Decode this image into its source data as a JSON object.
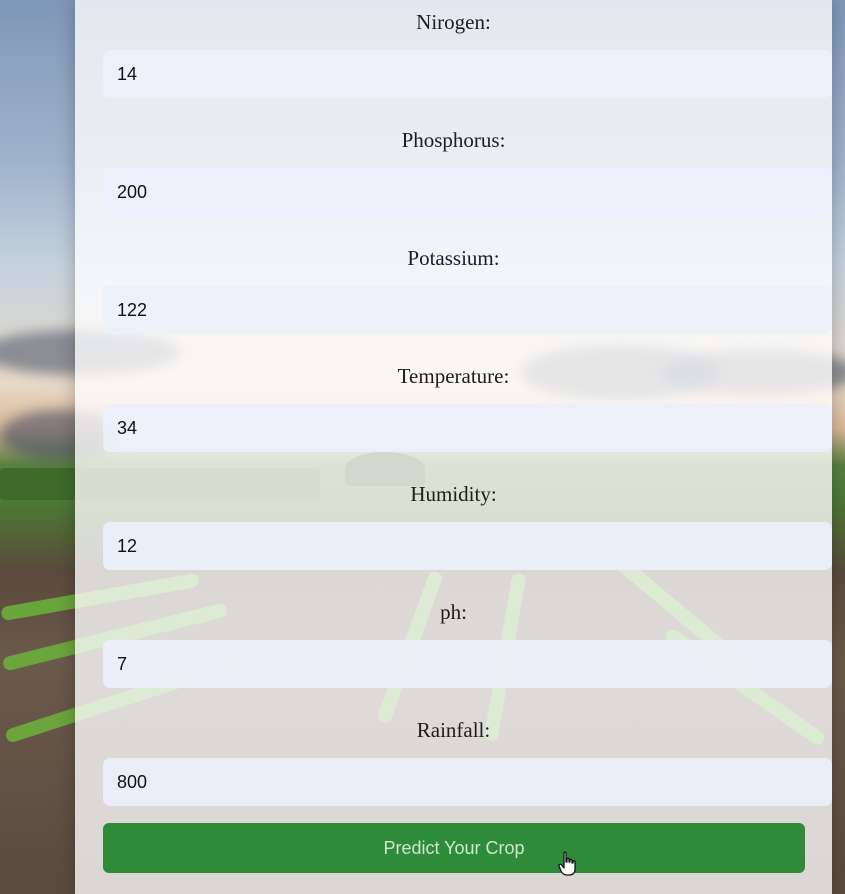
{
  "form": {
    "fields": [
      {
        "label": "Nirogen:",
        "value": "14"
      },
      {
        "label": "Phosphorus:",
        "value": "200"
      },
      {
        "label": "Potassium:",
        "value": "122"
      },
      {
        "label": "Temperature:",
        "value": "34"
      },
      {
        "label": "Humidity:",
        "value": "12"
      },
      {
        "label": "ph:",
        "value": "7"
      },
      {
        "label": "Rainfall:",
        "value": "800"
      }
    ],
    "submit_label": "Predict Your Crop"
  },
  "colors": {
    "button": "#2e8b3a",
    "card": "#ffffff",
    "input": "#ecf0fa"
  },
  "icons": {
    "cursor": "hand-pointer-icon"
  }
}
